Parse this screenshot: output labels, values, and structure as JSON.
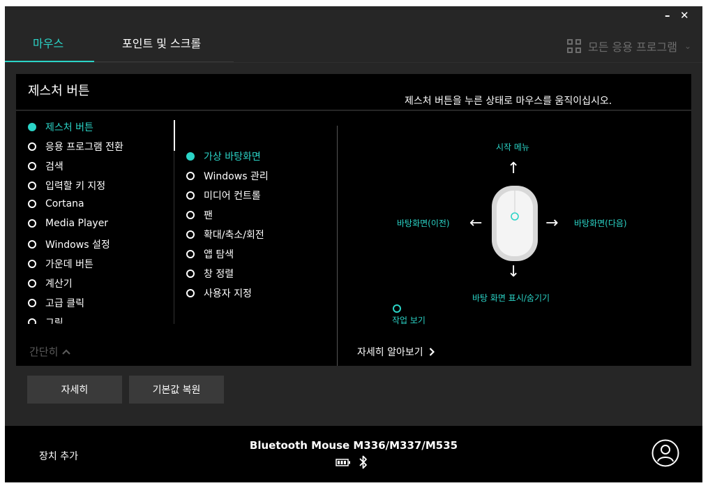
{
  "window": {
    "minimize_label": "–",
    "close_label": "✕"
  },
  "tabs": [
    {
      "label": "마우스",
      "active": true
    },
    {
      "label": "포인트 및 스크롤",
      "active": false
    }
  ],
  "apps_selector": {
    "label": "모든 응용 프로그램",
    "icon": "grid-icon"
  },
  "panel": {
    "title": "제스처 버튼",
    "instruction": "제스처 버튼을 누른 상태로 마우스를 움직이십시오.",
    "collapse_label": "간단히",
    "learn_more_label": "자세히 알아보기"
  },
  "action_list": [
    {
      "label": "제스처 버튼",
      "selected": true
    },
    {
      "label": "응용 프로그램 전환",
      "selected": false
    },
    {
      "label": "검색",
      "selected": false
    },
    {
      "label": "입력할 키 지정",
      "selected": false
    },
    {
      "label": "Cortana",
      "selected": false
    },
    {
      "label": "Media Player",
      "selected": false
    },
    {
      "label": "Windows 설정",
      "selected": false
    },
    {
      "label": "가운데 버튼",
      "selected": false
    },
    {
      "label": "계산기",
      "selected": false
    },
    {
      "label": "고급 클릭",
      "selected": false
    },
    {
      "label": "그림",
      "selected": false
    }
  ],
  "gesture_list": [
    {
      "label": "가상 바탕화면",
      "selected": true
    },
    {
      "label": "Windows 관리",
      "selected": false
    },
    {
      "label": "미디어 컨트롤",
      "selected": false
    },
    {
      "label": "팬",
      "selected": false
    },
    {
      "label": "확대/축소/회전",
      "selected": false
    },
    {
      "label": "앱 탐색",
      "selected": false
    },
    {
      "label": "창 정렬",
      "selected": false
    },
    {
      "label": "사용자 지정",
      "selected": false
    }
  ],
  "gesture_map": {
    "up": "시작 메뉴",
    "left": "바탕화면(이전)",
    "right": "바탕화면(다음)",
    "down": "바탕 화면 표시/숨기기",
    "click": "작업 보기"
  },
  "buttons": {
    "more_label": "자세히",
    "restore_label": "기본값 복원"
  },
  "footer": {
    "add_device_label": "장치 추가",
    "device_name": "Bluetooth Mouse M336/M337/M535",
    "battery_icon": "battery-icon",
    "bluetooth_icon": "bluetooth-icon",
    "account_icon": "account-icon"
  },
  "colors": {
    "accent": "#2bd4c7",
    "window_bg": "#262626",
    "panel_bg": "#000000"
  }
}
